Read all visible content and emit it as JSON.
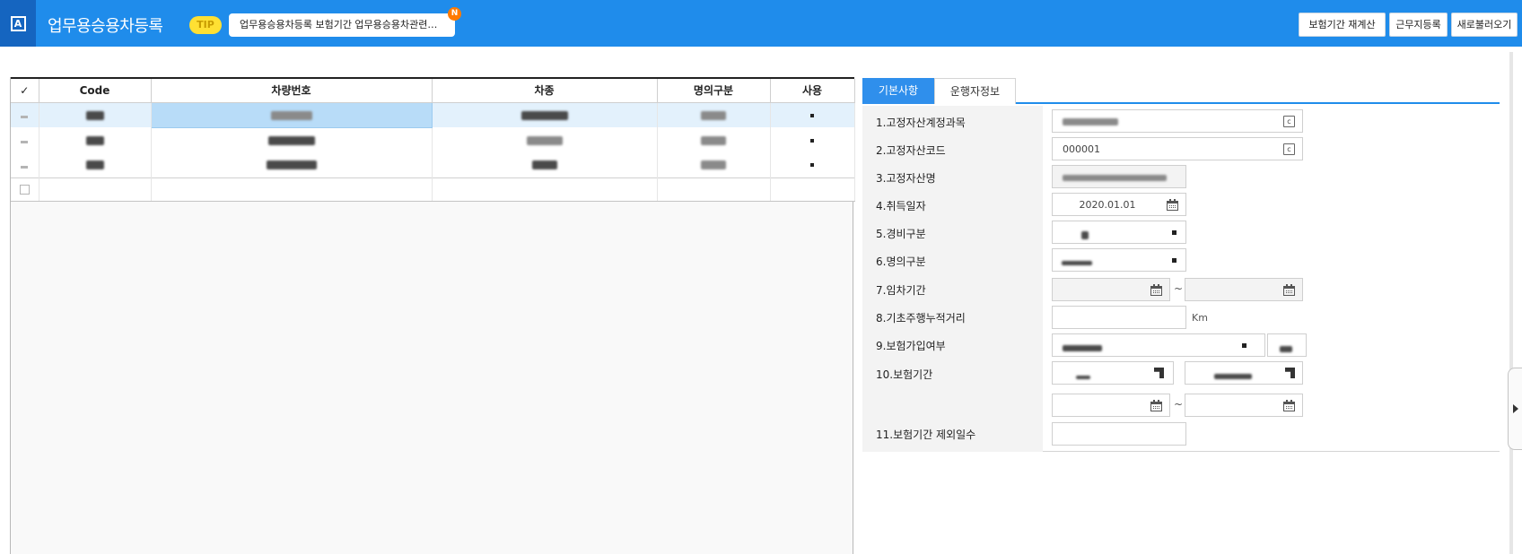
{
  "header": {
    "app_icon_letter": "A",
    "title": "업무용승용차등록",
    "tip_badge": "TIP",
    "tip_text": "업무용승용차등록 보험기간 업무용승용차관련비…",
    "new_badge": "N",
    "buttons": [
      "보험기간 재계산",
      "근무지등록",
      "새로불러오기"
    ]
  },
  "grid": {
    "columns": [
      "✓",
      "Code",
      "차량번호",
      "차종",
      "명의구분",
      "사용"
    ]
  },
  "detail": {
    "tabs": [
      "기본사항",
      "운행자정보"
    ],
    "fields": [
      {
        "label": "1.고정자산계정과목"
      },
      {
        "label": "2.고정자산코드",
        "value": "000001"
      },
      {
        "label": "3.고정자산명"
      },
      {
        "label": "4.취득일자",
        "value": "2020.01.01"
      },
      {
        "label": "5.경비구분"
      },
      {
        "label": "6.명의구분"
      },
      {
        "label": "7.임차기간"
      },
      {
        "label": "8.기초주행누적거리",
        "unit": "Km"
      },
      {
        "label": "9.보험가입여부"
      },
      {
        "label": "10.보험기간"
      },
      {
        "label": "11.보험기간 제외일수"
      }
    ],
    "range_separator": "~",
    "code_icon_letter": "c"
  },
  "icons": {
    "app": "app-logo-icon",
    "code_help": "code-help-icon",
    "calendar": "calendar-icon",
    "side_toggle": "chevron-right-icon"
  },
  "colors": {
    "header_blue": "#1f8ceb",
    "app_icon_blue": "#1565c0",
    "tip_yellow": "#ffe033",
    "new_orange": "#ff7a00",
    "selected_row": "#e3f1fc",
    "active_tab": "#2f8fec"
  }
}
